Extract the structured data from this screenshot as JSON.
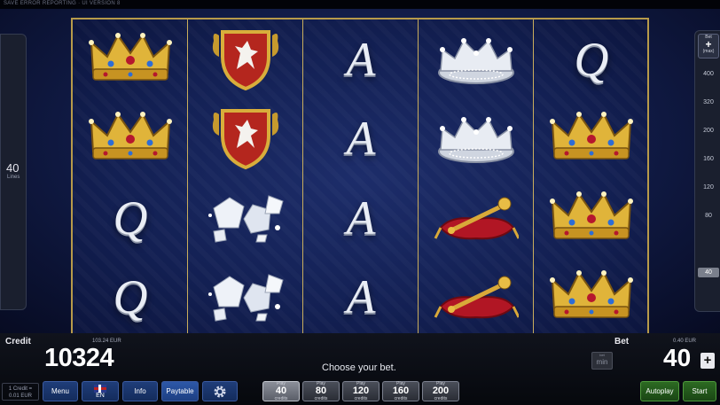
{
  "top_bar": {
    "text": "SAVE ERROR REPORTING · UI VERSION 8"
  },
  "left_panel": {
    "lines_value": "40",
    "lines_label": "Lines"
  },
  "right_panel": {
    "header_top": "Bet",
    "header_bottom": "(max)",
    "bet_steps": [
      "400",
      "320",
      "200",
      "160",
      "120",
      "80",
      "40"
    ],
    "selected_step": "40"
  },
  "reels": [
    [
      "gold-crown",
      "gold-crown",
      "letter-Q",
      "letter-Q"
    ],
    [
      "red-shield-crest",
      "red-shield-crest",
      "diamonds",
      "diamonds"
    ],
    [
      "letter-A",
      "letter-A",
      "letter-A",
      "letter-A"
    ],
    [
      "silver-crown",
      "silver-crown",
      "gold-scepter-pillow",
      "gold-scepter-pillow"
    ],
    [
      "letter-Q",
      "gold-crown",
      "gold-crown",
      "gold-crown"
    ]
  ],
  "letters": {
    "Q": "Q",
    "A": "A"
  },
  "credit": {
    "label": "Credit",
    "eur": "103.24 EUR",
    "value": "10324"
  },
  "bet": {
    "label": "Bet",
    "eur": "0.40 EUR",
    "value": "40",
    "min_top": "bet",
    "min_label": "min",
    "plus": "+"
  },
  "message": "Choose your bet.",
  "denomination": {
    "line1": "1 Credit =",
    "line2": "0.01 EUR"
  },
  "buttons": {
    "menu": "Menu",
    "language": "EN",
    "info": "Info",
    "paytable": "Paytable",
    "autoplay": "Autoplay",
    "start": "Start"
  },
  "play_buttons": [
    {
      "top": "Play",
      "value": "40",
      "bottom": "credits"
    },
    {
      "top": "Play",
      "value": "80",
      "bottom": "credits"
    },
    {
      "top": "Play",
      "value": "120",
      "bottom": "credits"
    },
    {
      "top": "Play",
      "value": "160",
      "bottom": "credits"
    },
    {
      "top": "Play",
      "value": "200",
      "bottom": "credits"
    }
  ],
  "colors": {
    "frame_gold": "#b79a4a",
    "panel_blue": "#142c5c",
    "start_green": "#2c6a22"
  }
}
